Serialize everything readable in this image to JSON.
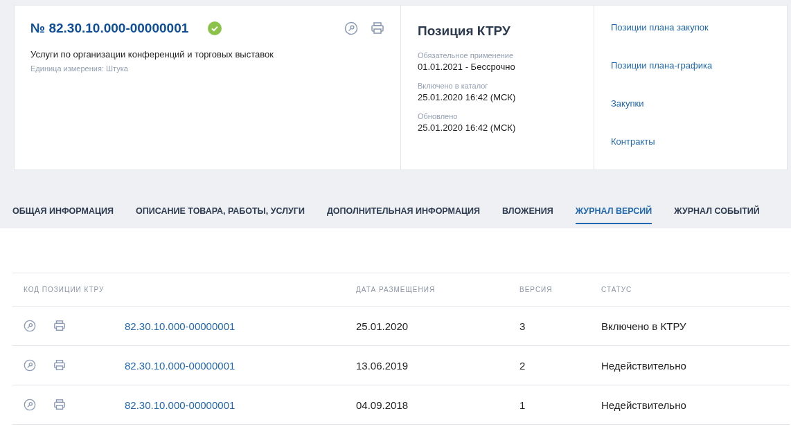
{
  "card": {
    "number": "№ 82.30.10.000-00000001",
    "verified": true,
    "description": "Услуги по организации конференций и торговых выставок",
    "unit": "Единица измерения: Штука"
  },
  "position": {
    "title": "Позиция КТРУ",
    "fields": [
      {
        "label": "Обязательное применение",
        "value": "01.01.2021  - Бессрочно"
      },
      {
        "label": "Включено в каталог",
        "value": "25.01.2020 16:42 (МСК)"
      },
      {
        "label": "Обновлено",
        "value": "25.01.2020 16:42 (МСК)"
      }
    ]
  },
  "links": [
    "Позиции плана закупок",
    "Позиции плана-графика",
    "Закупки",
    "Контракты"
  ],
  "tabs": [
    {
      "label": "ОБЩАЯ ИНФОРМАЦИЯ",
      "selected": false
    },
    {
      "label": "ОПИСАНИЕ ТОВАРА, РАБОТЫ, УСЛУГИ",
      "selected": false
    },
    {
      "label": "ДОПОЛНИТЕЛЬНАЯ ИНФОРМАЦИЯ",
      "selected": false
    },
    {
      "label": "ВЛОЖЕНИЯ",
      "selected": false
    },
    {
      "label": "ЖУРНАЛ ВЕРСИЙ",
      "selected": true
    },
    {
      "label": "ЖУРНАЛ СОБЫТИЙ",
      "selected": false
    }
  ],
  "table": {
    "columns": [
      "КОД ПОЗИЦИИ КТРУ",
      "ДАТА РАЗМЕЩЕНИЯ",
      "ВЕРСИЯ",
      "СТАТУС"
    ],
    "rows": [
      {
        "code": "82.30.10.000-00000001",
        "date": "25.01.2020",
        "version": "3",
        "status": "Включено в КТРУ"
      },
      {
        "code": "82.30.10.000-00000001",
        "date": "13.06.2019",
        "version": "2",
        "status": "Недействительно"
      },
      {
        "code": "82.30.10.000-00000001",
        "date": "04.09.2018",
        "version": "1",
        "status": "Недействительно"
      }
    ]
  }
}
